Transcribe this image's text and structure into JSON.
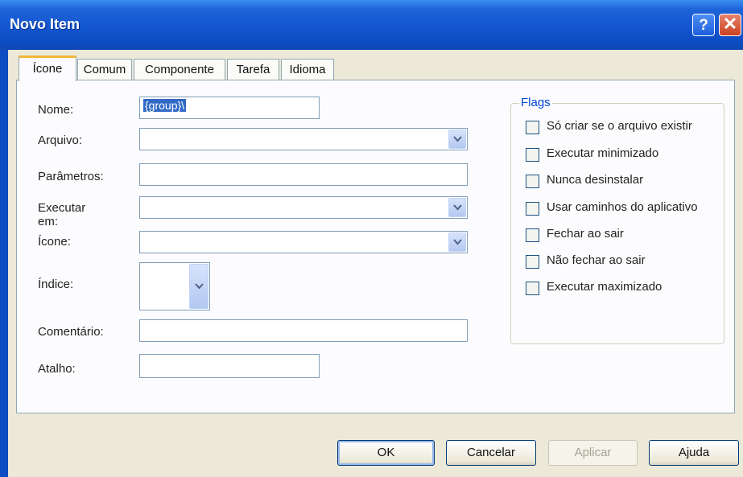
{
  "window": {
    "title": "Novo Item",
    "help_glyph": "?",
    "close_glyph": "✕"
  },
  "tabs": [
    {
      "label": "Ícone",
      "active": true
    },
    {
      "label": "Comum"
    },
    {
      "label": "Componente"
    },
    {
      "label": "Tarefa"
    },
    {
      "label": "Idioma"
    }
  ],
  "form": {
    "nome_label": "Nome:",
    "nome_value": "{group}\\",
    "arquivo_label": "Arquivo:",
    "arquivo_value": "",
    "parametros_label": "Parâmetros:",
    "parametros_value": "",
    "executar_em_label": "Executar em:",
    "executar_em_value": "",
    "icone_label": "Ícone:",
    "icone_value": "",
    "indice_label": "Índice:",
    "indice_value": "",
    "comentario_label": "Comentário:",
    "comentario_value": "",
    "atalho_label": "Atalho:",
    "atalho_value": ""
  },
  "flags": {
    "legend": "Flags",
    "items": [
      {
        "label": "Só criar se o arquivo existir",
        "checked": false
      },
      {
        "label": "Executar minimizado",
        "checked": false
      },
      {
        "label": "Nunca desinstalar",
        "checked": false
      },
      {
        "label": "Usar caminhos do aplicativo",
        "checked": false
      },
      {
        "label": "Fechar ao sair",
        "checked": false
      },
      {
        "label": "Não fechar ao sair",
        "checked": false
      },
      {
        "label": "Executar maximizado",
        "checked": false
      }
    ]
  },
  "buttons": {
    "ok": "OK",
    "cancel": "Cancelar",
    "apply": "Aplicar",
    "help": "Ajuda"
  },
  "colors": {
    "titlebar": "#1457d0",
    "dialog_bg": "#ece9d8",
    "panel_bg": "#fcfcfe",
    "accent": "#316ac5"
  }
}
